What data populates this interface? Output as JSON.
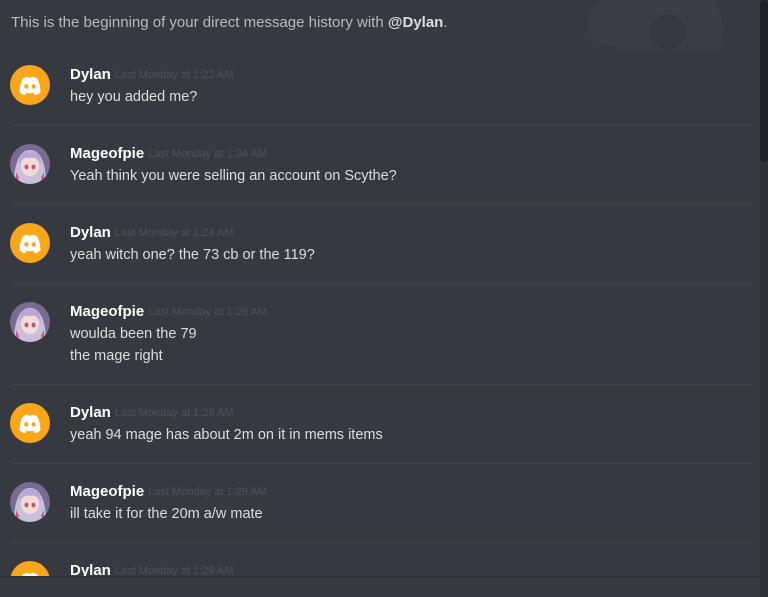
{
  "header": {
    "prefix": "This is the beginning of your direct message history with ",
    "mention": "@Dylan",
    "suffix": "."
  },
  "colors": {
    "background": "#36393f",
    "discord_avatar": "#faa61a",
    "author": "#ffffff",
    "message_text": "#dcddde",
    "timestamp": "#4f535a"
  },
  "messages": [
    {
      "author": "Dylan",
      "avatar": "discord-default-avatar-icon",
      "timestamp": "Last Monday at 1:22 AM",
      "lines": [
        "hey you added me?"
      ]
    },
    {
      "author": "Mageofpie",
      "avatar": "anime-character-avatar",
      "timestamp": "Last Monday at 1:24 AM",
      "lines": [
        "Yeah think you were selling an account on Scythe?"
      ]
    },
    {
      "author": "Dylan",
      "avatar": "discord-default-avatar-icon",
      "timestamp": "Last Monday at 1:24 AM",
      "lines": [
        "yeah witch one? the 73 cb or the 119?"
      ]
    },
    {
      "author": "Mageofpie",
      "avatar": "anime-character-avatar",
      "timestamp": "Last Monday at 1:26 AM",
      "lines": [
        "woulda been the 79",
        "the mage right"
      ]
    },
    {
      "author": "Dylan",
      "avatar": "discord-default-avatar-icon",
      "timestamp": "Last Monday at 1:26 AM",
      "lines": [
        "yeah 94 mage has about 2m on it in mems items"
      ]
    },
    {
      "author": "Mageofpie",
      "avatar": "anime-character-avatar",
      "timestamp": "Last Monday at 1:29 AM",
      "lines": [
        "ill take it for the 20m a/w mate"
      ]
    },
    {
      "author": "Dylan",
      "avatar": "discord-default-avatar-icon",
      "timestamp": "Last Monday at 1:29 AM",
      "lines": []
    }
  ]
}
